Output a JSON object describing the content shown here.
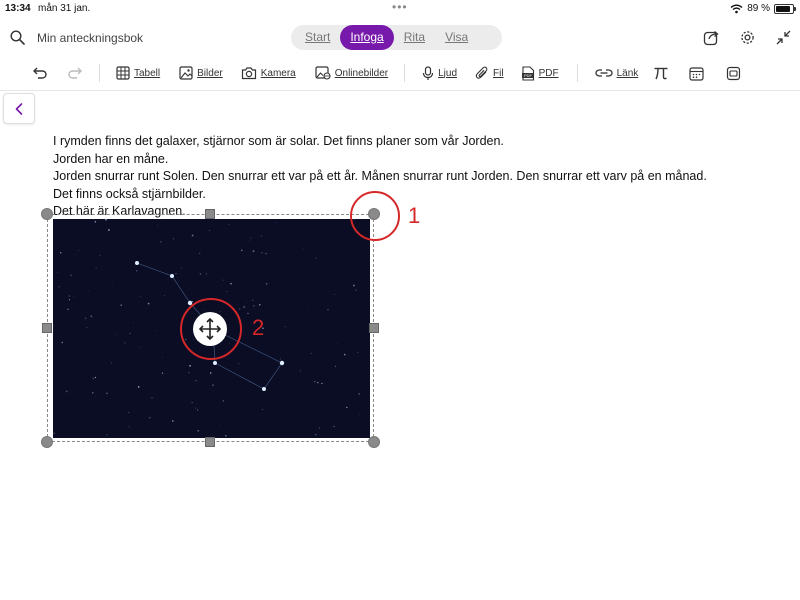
{
  "status": {
    "time": "13:34",
    "date": "mån 31 jan.",
    "battery_text": "89 %",
    "battery_level": 0.89
  },
  "header": {
    "notebook_title": "Min anteckningsbok",
    "tabs": [
      {
        "label": "Start",
        "active": false
      },
      {
        "label": "Infoga",
        "active": true
      },
      {
        "label": "Rita",
        "active": false
      },
      {
        "label": "Visa",
        "active": false
      }
    ],
    "accent_color": "#7719aa"
  },
  "toolbar": {
    "table_label": "Tabell",
    "pictures_label": "Bilder",
    "camera_label": "Kamera",
    "online_pictures_label": "Onlinebilder",
    "audio_label": "Ljud",
    "file_label": "Fil",
    "pdf_label": "PDF",
    "link_label": "Länk"
  },
  "content": {
    "lines": [
      "I rymden finns det galaxer, stjärnor som är solar. Det finns planer som vår Jorden.",
      "Jorden har en måne.",
      "Jorden snurrar runt Solen. Den snurrar ett var på ett år. Månen snurrar runt Jorden. Den snurrar ett varv på en månad.",
      "Det finns också stjärnbilder.",
      "Det här är Karlavagnen."
    ]
  },
  "annotations": {
    "one": "1",
    "two": "2",
    "color": "#d62828"
  }
}
